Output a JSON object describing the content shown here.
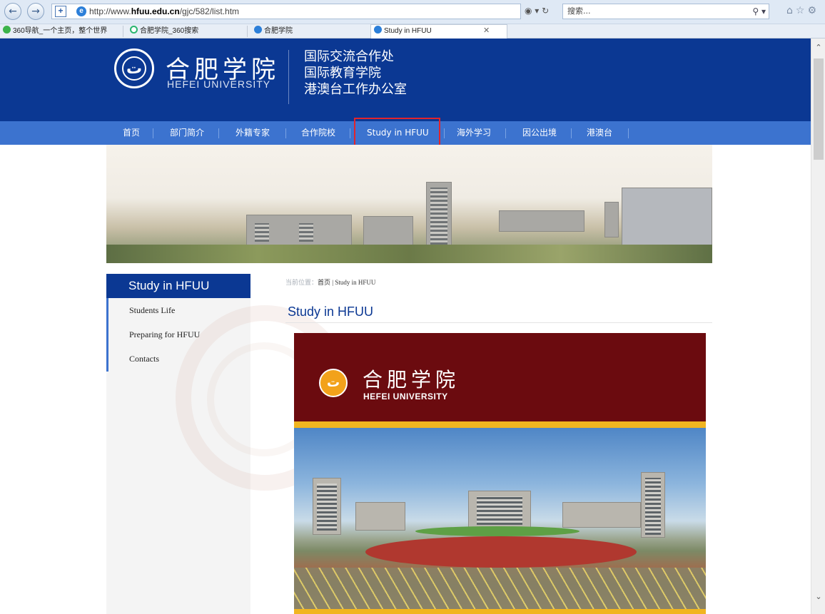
{
  "browser": {
    "url_prefix": "http://www.",
    "url_domain": "hfuu.edu.cn",
    "url_path": "/gjc/582/list.htm",
    "search_placeholder": "搜索...",
    "tabs": [
      {
        "label": "360导航_一个主页，整个世界",
        "fav_color": "#3bb34a"
      },
      {
        "label": "合肥学院_360搜索",
        "fav_color": "#2c7fd9"
      },
      {
        "label": "合肥学院",
        "fav_color": "#2c7fd9"
      },
      {
        "label": "Study in HFUU",
        "fav_color": "#2c7fd9",
        "active": true
      }
    ]
  },
  "header": {
    "logo_cn": "合肥学院",
    "logo_en": "HEFEI UNIVERSITY",
    "dept_line_1": "国际交流合作处",
    "dept_line_2": "国际教育学院",
    "dept_line_3": "港澳台工作办公室"
  },
  "nav": {
    "items": [
      "首页",
      "部门简介",
      "外籍专家",
      "合作院校",
      "Study in HFUU",
      "海外学习",
      "因公出境",
      "港澳台"
    ],
    "active": "Study in HFUU"
  },
  "sidebar": {
    "title": "Study in HFUU",
    "links": [
      "Students Life",
      "Preparing for HFUU",
      "Contacts"
    ]
  },
  "breadcrumb": {
    "prefix": "当前位置：",
    "home": "首页",
    "sep": " | ",
    "current": "Study in HFUU"
  },
  "main": {
    "title": "Study in HFUU"
  },
  "poster": {
    "logo_cn": "合肥学院",
    "logo_en": "HEFEI UNIVERSITY"
  },
  "colors": {
    "header_bg": "#0b3893",
    "nav_bg": "#3c73cf",
    "highlight": "#e2242c",
    "poster_red": "#6b0b0f",
    "poster_gold": "#f1b520"
  }
}
